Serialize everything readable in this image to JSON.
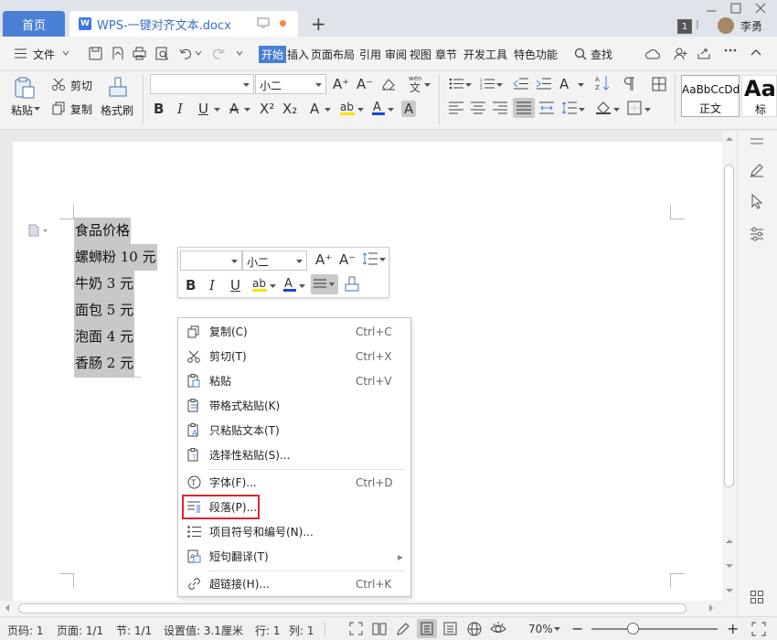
{
  "titlebar": {
    "home_tab": "首页",
    "doc_tab": "WPS-一键对齐文本.docx",
    "doc_icon": "W",
    "new_tab": "+",
    "badge": "1",
    "user": "李勇"
  },
  "menubar": {
    "file": "文件",
    "items": [
      "开始",
      "插入",
      "页面布局",
      "引用",
      "审阅",
      "视图",
      "章节",
      "开发工具",
      "特色功能"
    ],
    "search": "查找"
  },
  "ribbon": {
    "paste": "粘贴",
    "cut": "剪切",
    "copy": "复制",
    "format_painter": "格式刷",
    "font_name": "",
    "font_size": "小二",
    "style_preview": "AaBbCcDd",
    "style_name": "正文",
    "style2_preview": "Aa",
    "style2_name": "标"
  },
  "document": {
    "lines": [
      "食品价格",
      "螺蛳粉 10 元",
      "牛奶 3 元",
      "面包 5 元",
      "泡面 4 元",
      "香肠 2 元"
    ]
  },
  "mini_toolbar": {
    "font_name": "",
    "font_size": "小二"
  },
  "context_menu": {
    "items": [
      {
        "label": "复制(C)",
        "shortcut": "Ctrl+C",
        "icon": "copy-icon"
      },
      {
        "label": "剪切(T)",
        "shortcut": "Ctrl+X",
        "icon": "scissors-icon"
      },
      {
        "label": "粘贴",
        "shortcut": "Ctrl+V",
        "icon": "paste-icon"
      },
      {
        "label": "带格式粘贴(K)",
        "shortcut": "",
        "icon": "paste-format-icon"
      },
      {
        "label": "只粘贴文本(T)",
        "shortcut": "",
        "icon": "paste-text-icon"
      },
      {
        "label": "选择性粘贴(S)...",
        "shortcut": "",
        "icon": "paste-special-icon"
      },
      {
        "label": "字体(F)...",
        "shortcut": "Ctrl+D",
        "icon": "font-icon"
      },
      {
        "label": "段落(P)...",
        "shortcut": "",
        "icon": "paragraph-icon"
      },
      {
        "label": "项目符号和编号(N)...",
        "shortcut": "",
        "icon": "list-icon"
      },
      {
        "label": "短句翻译(T)",
        "shortcut": "",
        "icon": "translate-icon"
      },
      {
        "label": "超链接(H)...",
        "shortcut": "Ctrl+K",
        "icon": "link-icon"
      }
    ]
  },
  "status": {
    "page_num": "页码: 1",
    "pages": "页面: 1/1",
    "section": "节: 1/1",
    "setting": "设置值: 3.1厘米",
    "row": "行: 1",
    "col": "列: 1",
    "zoom": "70%",
    "zoom_minus": "−",
    "zoom_plus": "+"
  },
  "colors": {
    "accent": "#4a7fd6",
    "highlight_box": "#e0242f",
    "selection": "#c8c8c8"
  }
}
